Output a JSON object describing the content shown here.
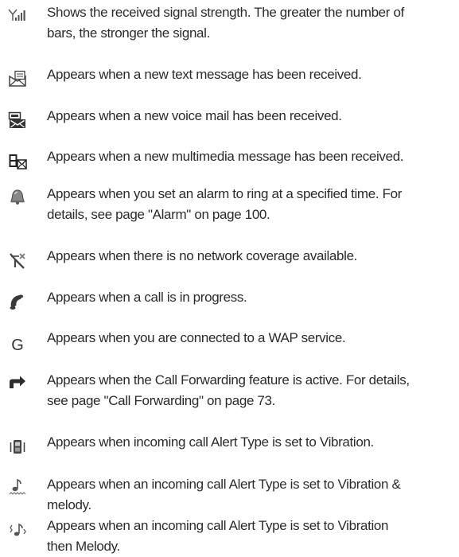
{
  "icons": [
    {
      "icon": "signal-strength-icon",
      "description": "Shows the received signal strength. The greater the number of\nbars, the stronger the signal."
    },
    {
      "icon": "text-message-icon",
      "description": "Appears when a new text message has been received."
    },
    {
      "icon": "voice-mail-icon",
      "description": "Appears when a new voice mail has been received."
    },
    {
      "icon": "multimedia-message-icon",
      "description": "Appears when a new multimedia message has been received."
    },
    {
      "icon": "alarm-icon",
      "description": "Appears when you set an alarm to ring at a specified time. For\ndetails, see page \"Alarm\" on page 100."
    },
    {
      "icon": "no-network-icon",
      "description": "Appears when there is no network coverage available."
    },
    {
      "icon": "call-in-progress-icon",
      "description": "Appears when a call is in progress."
    },
    {
      "icon": "wap-service-icon",
      "glyph": "G",
      "description": "Appears when you are connected to a WAP service."
    },
    {
      "icon": "call-forwarding-icon",
      "description": "Appears when the Call Forwarding feature is active. For details,\nsee page \"Call Forwarding\" on page 73."
    },
    {
      "icon": "vibration-icon",
      "description": "Appears when incoming call Alert Type is set to Vibration."
    },
    {
      "icon": "vibration-and-melody-icon",
      "description": "Appears when an incoming call Alert Type is set to Vibration &\nmelody."
    },
    {
      "icon": "vibration-then-melody-icon",
      "description": "Appears when an incoming call Alert Type is set to Vibration\nthen Melody."
    }
  ]
}
